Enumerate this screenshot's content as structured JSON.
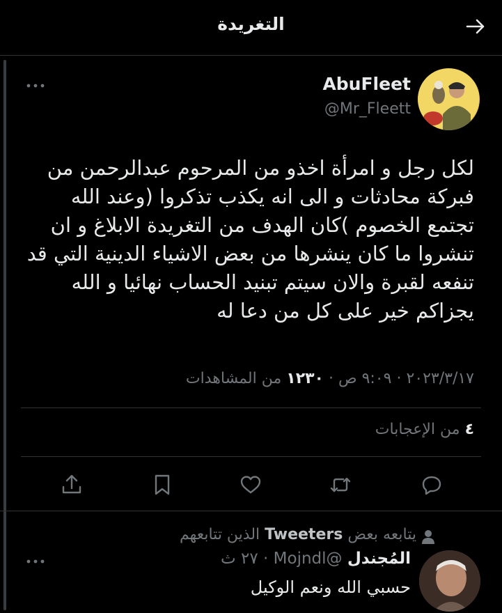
{
  "header": {
    "title": "التغريدة",
    "back_icon": "arrow-right-icon"
  },
  "tweet": {
    "author_name": "AbuFleet",
    "author_handle": "@Mr_Fleett",
    "more_icon": "more-horizontal-icon",
    "text": "لكل رجل و امرأة اخذو من المرحوم عبدالرحمن من فبركة محادثات و الى انه يكذب تذكروا (وعند الله تجتمع الخصوم )كان الهدف من التغريدة الابلاغ و ان تنشروا ما كان ينشرها من بعض الاشياء الدينية التي قد تنفعه لقبرة والان سيتم تبنيد الحساب نهائيا و الله يجزاكم خير على كل من دعا له",
    "date": "٢٠٢٣/٣/١٧",
    "time": "٩:٠٩ ص",
    "separator": "·",
    "views_count": "١٢٣٠",
    "views_label": "من المشاهدات",
    "likes_count": "٤",
    "likes_label": "من الإعجابات"
  },
  "actions": {
    "reply_icon": "reply-icon",
    "retweet_icon": "retweet-icon",
    "like_icon": "heart-icon",
    "bookmark_icon": "bookmark-icon",
    "share_icon": "share-icon"
  },
  "reply": {
    "social_context_prefix": "يتابعه بعض",
    "social_context_tweeters": "Tweeters",
    "social_context_suffix": "الذين تتابعهم",
    "social_icon": "person-icon",
    "name": "المُجندل",
    "handle": "@Mojndl",
    "separator": "·",
    "time": "٢٧ ث",
    "text": "حسبي الله ونعم الوكيل",
    "more_icon": "more-horizontal-icon"
  },
  "colors": {
    "background": "#000000",
    "text_primary": "#e7e9ea",
    "text_secondary": "#71767b",
    "divider": "#2f3336"
  }
}
